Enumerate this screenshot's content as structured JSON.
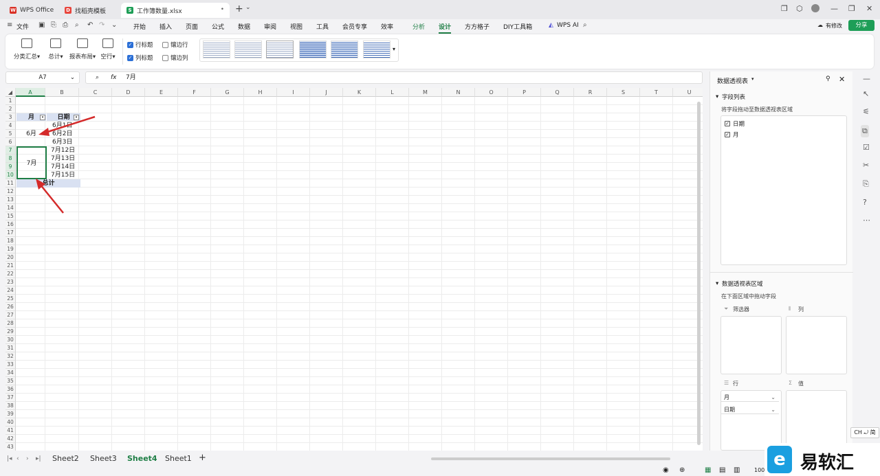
{
  "tabs": [
    {
      "label": "WPS Office",
      "icon": "W"
    },
    {
      "label": "找稻壳模板",
      "icon": "D"
    },
    {
      "label": "工作簿数量.xlsx",
      "icon": "S"
    }
  ],
  "menu": {
    "file": "文件",
    "items": [
      "开始",
      "插入",
      "页面",
      "公式",
      "数据",
      "审阅",
      "视图",
      "工具",
      "会员专享",
      "效率"
    ],
    "analysis": "分析",
    "design": "设计",
    "fangfang": "方方格子",
    "diy": "DIY工具箱",
    "wpsai": "WPS AI",
    "modify": "有修改",
    "share": "分享"
  },
  "ribbon": {
    "subtotal": "分类汇总",
    "grandtotal": "总计",
    "layout": "报表布局",
    "blankrow": "空行",
    "row_header": "行标题",
    "col_header": "列标题",
    "banded_rows": "镶边行",
    "banded_cols": "镶边列"
  },
  "formula": {
    "cell_ref": "A7",
    "fx": "fx",
    "content": "7月"
  },
  "grid": {
    "columns": [
      "A",
      "B",
      "C",
      "D",
      "E",
      "F",
      "G",
      "H",
      "I",
      "J",
      "K",
      "L",
      "M",
      "N",
      "O",
      "P",
      "Q",
      "R",
      "S",
      "T",
      "U"
    ],
    "rows": [
      "1",
      "2",
      "3",
      "4",
      "5",
      "6",
      "7",
      "8",
      "9",
      "10",
      "11",
      "12",
      "13",
      "14",
      "15",
      "16",
      "17",
      "18",
      "19",
      "20",
      "21",
      "22",
      "23",
      "24",
      "25",
      "26",
      "27",
      "28",
      "29",
      "30",
      "31",
      "32",
      "33",
      "34",
      "35",
      "36",
      "37",
      "38",
      "39",
      "40",
      "41",
      "42",
      "43"
    ],
    "hdr_month": "月",
    "hdr_date": "日期",
    "month_june": "6月",
    "month_july": "7月",
    "dates": [
      "6月1日",
      "6月2日",
      "6月3日",
      "7月12日",
      "7月13日",
      "7月14日",
      "7月15日"
    ],
    "total": "总计"
  },
  "sheets": [
    "Sheet2",
    "Sheet3",
    "Sheet4",
    "Sheet1"
  ],
  "active_sheet": "Sheet4",
  "panel": {
    "title": "数据透视表",
    "field_list": "字段列表",
    "drag_hint": "将字段拖动至数据透视表区域",
    "fields": [
      "日期",
      "月"
    ],
    "area_title": "数据透视表区域",
    "area_hint": "在下面区域中拖动字段",
    "filter": "筛选器",
    "column": "列",
    "row": "行",
    "value": "值",
    "row_fields": [
      "月",
      "日期"
    ]
  },
  "ime": "CH ⤾ 简",
  "zoom": "100",
  "watermark": "易软汇",
  "colors": {
    "accent": "#1e7e45",
    "header_fill": "#d9e1f2"
  }
}
